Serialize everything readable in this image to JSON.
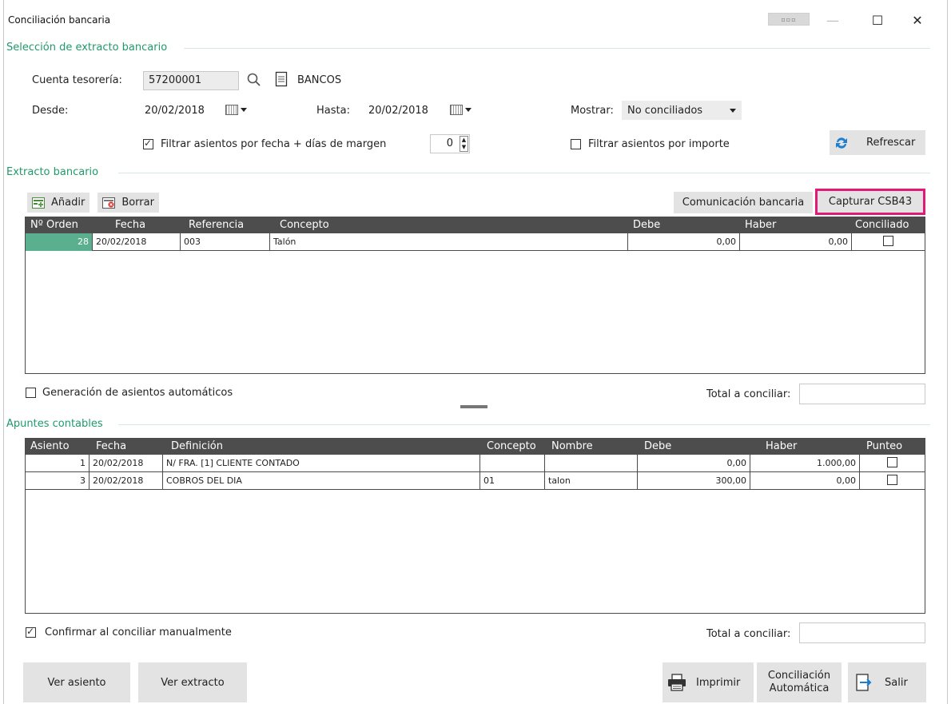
{
  "window": {
    "title": "Conciliación bancaria",
    "more_label": "▫▫▫",
    "minimize": "—",
    "maximize": "☐",
    "close": "✕"
  },
  "seleccion": {
    "section_title": "Selección de extracto bancario",
    "cuenta_label": "Cuenta tesorería:",
    "cuenta_value": "57200001",
    "cuenta_name": "BANCOS",
    "desde_label": "Desde:",
    "desde_value": "20/02/2018",
    "hasta_label": "Hasta:",
    "hasta_value": "20/02/2018",
    "mostrar_label": "Mostrar:",
    "mostrar_value": "No conciliados",
    "filtrar_fecha_label": "Filtrar asientos por fecha + días de margen",
    "margen_value": "0",
    "filtrar_importe_label": "Filtrar asientos por importe",
    "refrescar_label": "Refrescar"
  },
  "extracto": {
    "section_title": "Extracto bancario",
    "add_label": "Añadir",
    "delete_label": "Borrar",
    "comunicacion_label": "Comunicación bancaria",
    "capturar_label": "Capturar CSB43",
    "columns": [
      "Nº Orden",
      "Fecha",
      "Referencia",
      "Concepto",
      "Debe",
      "Haber",
      "Conciliado"
    ],
    "rows": [
      {
        "orden": "28",
        "fecha": "20/02/2018",
        "referencia": "003",
        "concepto": "Talón",
        "debe": "0,00",
        "haber": "0,00",
        "conciliado": false
      }
    ],
    "generacion_label": "Generación de asientos automáticos",
    "total_label": "Total a conciliar:",
    "total_value": ""
  },
  "apuntes": {
    "section_title": "Apuntes contables",
    "columns": [
      "Asiento",
      "Fecha",
      "Definición",
      "Concepto",
      "Nombre",
      "Debe",
      "Haber",
      "Punteo"
    ],
    "rows": [
      {
        "asiento": "1",
        "fecha": "20/02/2018",
        "definicion": "N/ FRA. [1] CLIENTE CONTADO",
        "concepto": "",
        "nombre": "",
        "debe": "0,00",
        "haber": "1.000,00",
        "punteo": false
      },
      {
        "asiento": "3",
        "fecha": "20/02/2018",
        "definicion": "COBROS DEL DIA",
        "concepto": "01",
        "nombre": "talon",
        "debe": "300,00",
        "haber": "0,00",
        "punteo": false
      }
    ],
    "confirmar_label": "Confirmar al conciliar manualmente",
    "total_label": "Total a conciliar:",
    "total_value": ""
  },
  "footer": {
    "ver_asiento": "Ver asiento",
    "ver_extracto": "Ver extracto",
    "imprimir": "Imprimir",
    "conciliacion_line1": "Conciliación",
    "conciliacion_line2": "Automática",
    "salir": "Salir"
  },
  "colors": {
    "section": "#1f9a6b",
    "highlight": "#e3197a",
    "grid_header": "#4d4d4d",
    "selected_cell": "#5aaf8e"
  }
}
